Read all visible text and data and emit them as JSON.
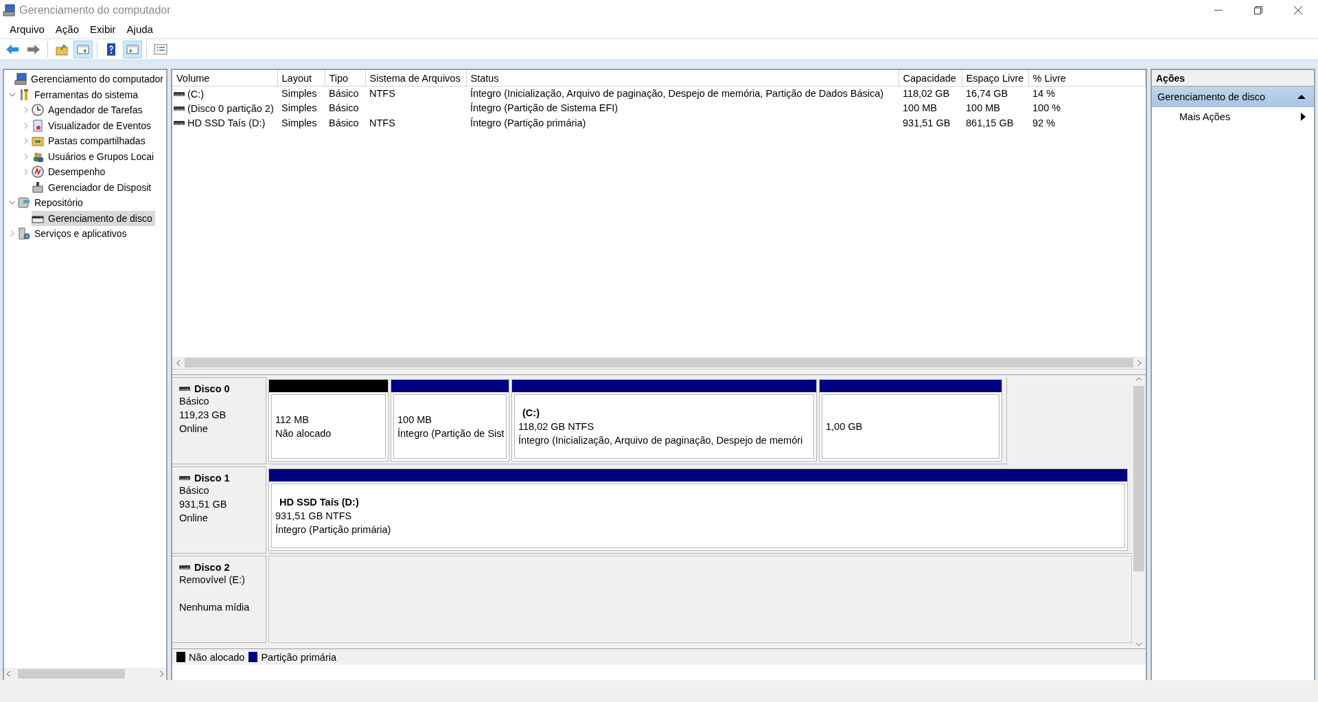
{
  "window": {
    "title": "Gerenciamento do computador"
  },
  "menu": [
    "Arquivo",
    "Ação",
    "Exibir",
    "Ajuda"
  ],
  "toolbar": [
    {
      "kind": "back",
      "pressed": false
    },
    {
      "kind": "forward",
      "pressed": false
    },
    {
      "kind": "separator"
    },
    {
      "kind": "up",
      "pressed": false
    },
    {
      "kind": "tree-pane",
      "pressed": true
    },
    {
      "kind": "separator"
    },
    {
      "kind": "help",
      "pressed": false
    },
    {
      "kind": "action-pane",
      "pressed": true
    },
    {
      "kind": "separator"
    },
    {
      "kind": "properties",
      "pressed": false
    }
  ],
  "tree": [
    {
      "label": "Gerenciamento do computador",
      "kind": "computer",
      "selected": false,
      "children": [
        {
          "label": "Ferramentas do sistema",
          "kind": "tools",
          "expandable": true,
          "expanded": true,
          "selected": false,
          "children": [
            {
              "label": "Agendador de Tarefas",
              "kind": "clock",
              "expandable": true,
              "expanded": false,
              "selected": false
            },
            {
              "label": "Visualizador de Eventos",
              "kind": "log",
              "expandable": true,
              "expanded": false,
              "selected": false
            },
            {
              "label": "Pastas compartilhadas",
              "kind": "share",
              "expandable": true,
              "expanded": false,
              "selected": false
            },
            {
              "label": "Usuários e Grupos Locai",
              "kind": "users",
              "expandable": true,
              "expanded": false,
              "selected": false
            },
            {
              "label": "Desempenho",
              "kind": "perf",
              "expandable": true,
              "expanded": false,
              "selected": false
            },
            {
              "label": "Gerenciador de Disposit",
              "kind": "device",
              "expandable": false,
              "selected": false
            }
          ]
        },
        {
          "label": "Repositório",
          "kind": "storage",
          "expandable": true,
          "expanded": true,
          "selected": false,
          "children": [
            {
              "label": "Gerenciamento de disco",
              "kind": "disk",
              "expandable": false,
              "selected": true
            }
          ]
        },
        {
          "label": "Serviços e aplicativos",
          "kind": "services",
          "expandable": true,
          "expanded": false,
          "selected": false
        }
      ]
    }
  ],
  "volumes": {
    "columns": [
      "Volume",
      "Layout",
      "Tipo",
      "Sistema de Arquivos",
      "Status",
      "Capacidade",
      "Espaço Livre",
      "% Livre"
    ],
    "rows": [
      {
        "cells": [
          "(C:)",
          "Simples",
          "Básico",
          "NTFS",
          "Íntegro (Inicialização, Arquivo de paginação, Despejo de memória, Partição de Dados Básica)",
          "118,02 GB",
          "16,74 GB",
          "14 %"
        ]
      },
      {
        "cells": [
          "(Disco 0 partição 2)",
          "Simples",
          "Básico",
          null,
          "Íntegro (Partição de Sistema EFI)",
          "100 MB",
          "100 MB",
          "100 %"
        ]
      },
      {
        "cells": [
          "HD SSD Taís (D:)",
          "Simples",
          "Básico",
          "NTFS",
          "Íntegro (Partição primária)",
          "931,51 GB",
          "861,15 GB",
          "92 %"
        ]
      }
    ]
  },
  "disks": [
    {
      "name": "Disco 0",
      "type": "Básico",
      "size": "119,23 GB",
      "status": "Online",
      "partitions": [
        {
          "color": "#000000",
          "lines": [
            "112 MB",
            "Não alocado"
          ]
        },
        {
          "color": "#000080",
          "lines": [
            "100 MB",
            "Íntegro (Partição de Sist"
          ]
        },
        {
          "color": "#000080",
          "title": "(C:)",
          "lines": [
            "118,02 GB NTFS",
            "Íntegro (Inicialização, Arquivo de paginação, Despejo de memóri"
          ]
        },
        {
          "color": "#000080",
          "lines": [
            "1,00 GB"
          ]
        }
      ]
    },
    {
      "name": "Disco 1",
      "type": "Básico",
      "size": "931,51 GB",
      "status": "Online",
      "partitions": [
        {
          "color": "#000080",
          "title": "HD SSD Taís  (D:)",
          "lines": [
            "931,51 GB NTFS",
            "Íntegro (Partição primária)"
          ]
        }
      ]
    },
    {
      "name": "Disco 2",
      "type": "Removível (E:)",
      "status": "Nenhuma mídia"
    }
  ],
  "legend": [
    {
      "label": "Não alocado",
      "color": "#000000"
    },
    {
      "label": "Partição primária",
      "color": "#000080"
    }
  ],
  "actions": {
    "title": "Ações",
    "items": [
      {
        "kind": "header",
        "label": "Gerenciamento de disco",
        "expanded": true
      },
      {
        "kind": "item",
        "label": "Mais Ações"
      }
    ]
  }
}
